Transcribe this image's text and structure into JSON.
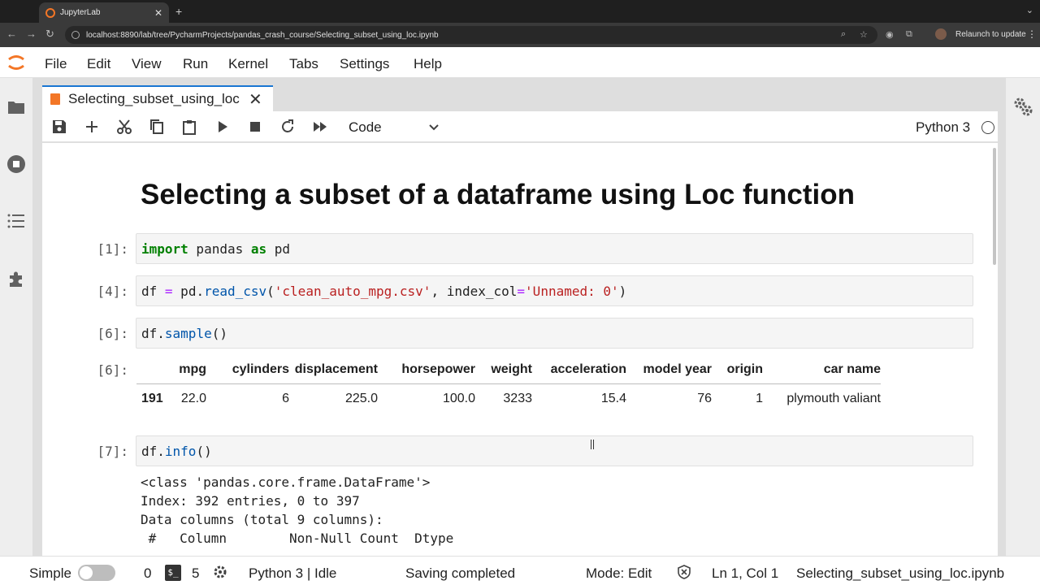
{
  "browser": {
    "tab_title": "JupyterLab",
    "url": "localhost:8890/lab/tree/PycharmProjects/pandas_crash_course/Selecting_subset_using_loc.ipynb",
    "relaunch_label": "Relaunch to update"
  },
  "menu": [
    "File",
    "Edit",
    "View",
    "Run",
    "Kernel",
    "Tabs",
    "Settings",
    "Help"
  ],
  "doc_tab": {
    "name": "Selecting_subset_using_loc"
  },
  "toolbar": {
    "cell_type": "Code",
    "kernel": "Python 3"
  },
  "notebook": {
    "title": "Selecting a subset of a dataframe using Loc function",
    "cells": [
      {
        "prompt": "[1]:"
      },
      {
        "prompt": "[4]:"
      },
      {
        "prompt": "[6]:"
      },
      {
        "prompt": "[7]:"
      }
    ],
    "output_prompt": "[6]:",
    "sample_table": {
      "columns": [
        "",
        "mpg",
        "cylinders",
        "displacement",
        "horsepower",
        "weight",
        "acceleration",
        "model year",
        "origin",
        "car name"
      ],
      "rows": [
        [
          "191",
          "22.0",
          "6",
          "225.0",
          "100.0",
          "3233",
          "15.4",
          "76",
          "1",
          "plymouth valiant"
        ]
      ]
    },
    "info_output": [
      "<class 'pandas.core.frame.DataFrame'>",
      "Index: 392 entries, 0 to 397",
      "Data columns (total 9 columns):",
      " #   Column        Non-Null Count  Dtype"
    ]
  },
  "statusbar": {
    "mode_label": "Simple",
    "count_a": "0",
    "count_b": "5",
    "kernel_status": "Python 3 | Idle",
    "save_status": "Saving completed",
    "edit_mode": "Mode: Edit",
    "cursor_pos": "Ln 1, Col 1",
    "filename": "Selecting_subset_using_loc.ipynb"
  }
}
